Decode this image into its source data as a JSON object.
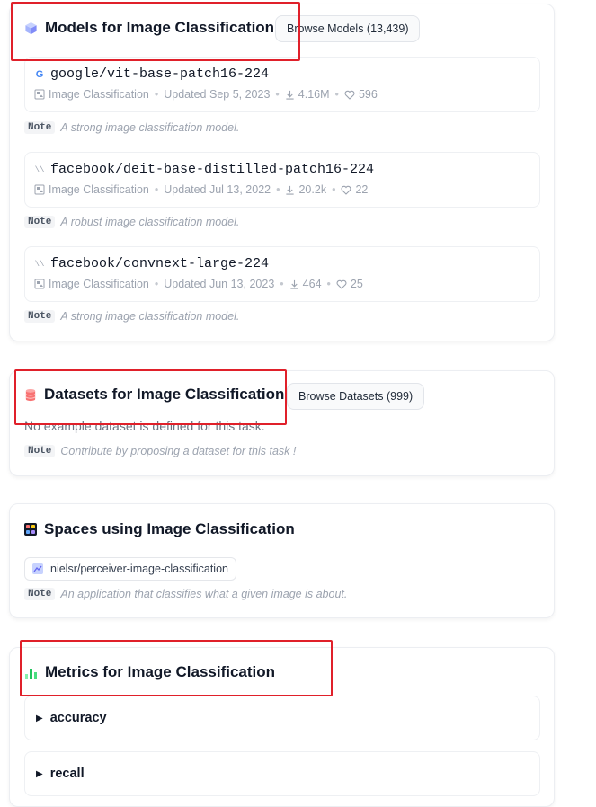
{
  "models": {
    "title": "Models for Image Classification",
    "browse": "Browse Models (13,439)",
    "note_tag": "Note",
    "items": [
      {
        "name": "google/vit-base-patch16-224",
        "task": "Image Classification",
        "updated": "Updated Sep 5, 2023",
        "downloads": "4.16M",
        "likes": "596",
        "note": "A strong image classification model."
      },
      {
        "name": "facebook/deit-base-distilled-patch16-224",
        "task": "Image Classification",
        "updated": "Updated Jul 13, 2022",
        "downloads": "20.2k",
        "likes": "22",
        "note": "A robust image classification model."
      },
      {
        "name": "facebook/convnext-large-224",
        "task": "Image Classification",
        "updated": "Updated Jun 13, 2023",
        "downloads": "464",
        "likes": "25",
        "note": "A strong image classification model."
      }
    ]
  },
  "datasets": {
    "title": "Datasets for Image Classification",
    "browse": "Browse Datasets (999)",
    "empty": "No example dataset is defined for this task.",
    "note_tag": "Note",
    "note": "Contribute by proposing a dataset for this task !"
  },
  "spaces": {
    "title": "Spaces using Image Classification",
    "items": [
      {
        "name": "nielsr/perceiver-image-classification"
      }
    ],
    "note_tag": "Note",
    "note": "An application that classifies what a given image is about."
  },
  "metrics": {
    "title": "Metrics for Image Classification",
    "items": [
      {
        "label": "accuracy"
      },
      {
        "label": "recall"
      }
    ]
  },
  "colors": {
    "highlight": "#e0202a",
    "muted": "#9ca3af",
    "text": "#111827"
  }
}
